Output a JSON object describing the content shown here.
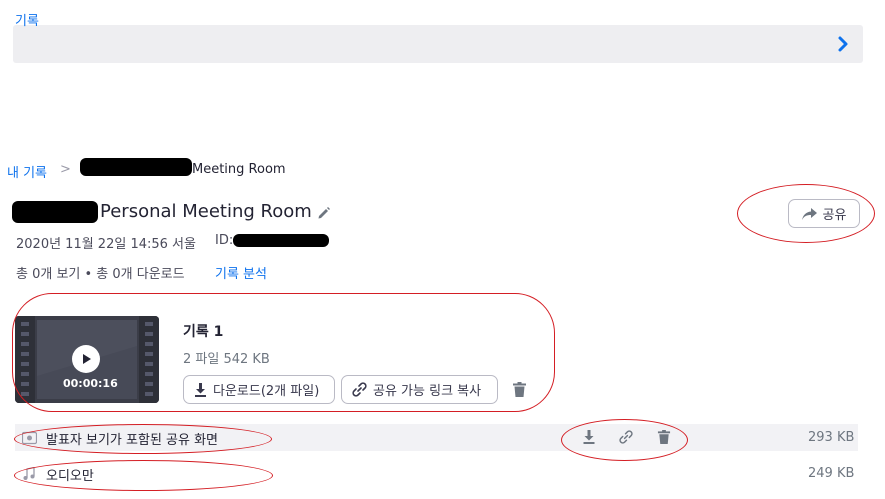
{
  "section_bar": {
    "label": "기록"
  },
  "breadcrumb": {
    "home": "내 기록",
    "separator": ">",
    "current_suffix": "Meeting Room"
  },
  "title": {
    "text_suffix": "Personal Meeting Room"
  },
  "share_button": {
    "label": "공유"
  },
  "meta": {
    "datetime": "2020년 11월 22일 14:56 서울",
    "id_label": "ID:"
  },
  "stats": {
    "views_downloads": "총 0개 보기 • 총 0개 다운로드",
    "analysis_link": "기록 분석"
  },
  "recording": {
    "title": "기록 1",
    "files_size": "2 파일   542 KB",
    "duration": "00:00:16",
    "download_button": "다운로드(2개 파일)",
    "copy_link_button": "공유 가능 링크 복사"
  },
  "files": [
    {
      "name": "발표자 보기가 포함된 공유 화면",
      "size": "293 KB",
      "icon": "video-file-icon"
    },
    {
      "name": "오디오만",
      "size": "249 KB",
      "icon": "audio-file-icon"
    }
  ],
  "colors": {
    "accent": "#0e72ed",
    "annotation": "#d41e24"
  }
}
